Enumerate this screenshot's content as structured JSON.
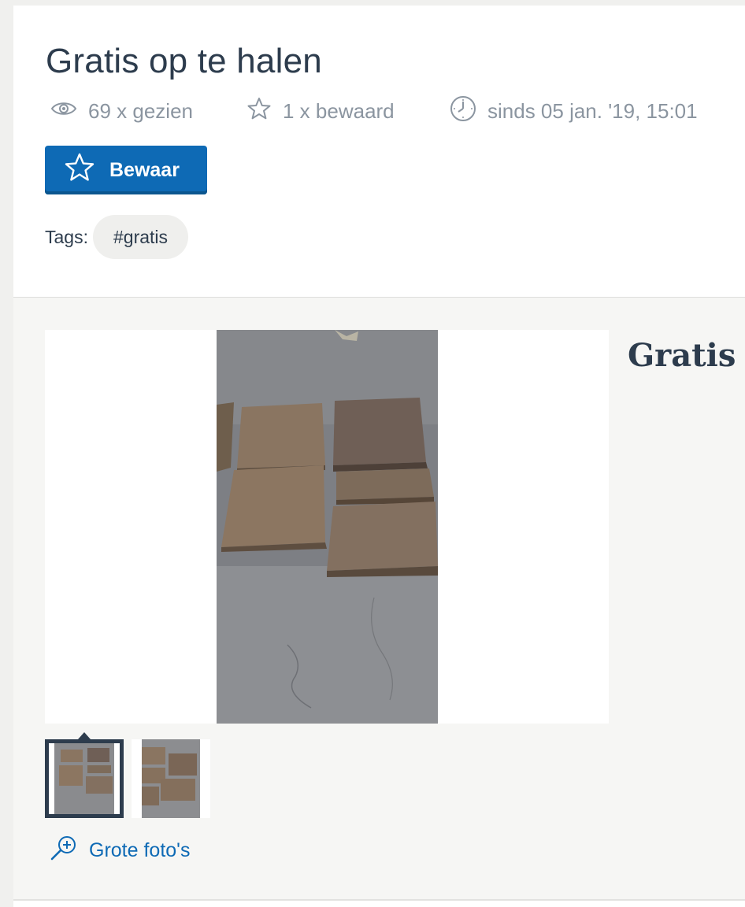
{
  "header": {
    "title": "Gratis op te halen",
    "stats": {
      "views": "69 x gezien",
      "saves": "1 x bewaard",
      "since": "sinds 05 jan. '19, 15:01"
    },
    "save_button_label": "Bewaar",
    "tags_label": "Tags:",
    "tags": [
      "#gratis"
    ]
  },
  "gallery": {
    "thumbnail_count": 2,
    "selected_thumbnail": 1,
    "large_photos_link": "Grote foto's"
  },
  "side": {
    "title": "Gratis"
  },
  "colors": {
    "primary": "#0e6ab5",
    "text": "#2d3c4d",
    "muted": "#8b95a0",
    "page_bg": "#f6f6f4"
  },
  "icons": {
    "views": "eye-icon",
    "saves": "star-outline-icon",
    "since": "clock-icon",
    "save_button": "star-outline-icon",
    "large_photos": "zoom-in-icon"
  }
}
